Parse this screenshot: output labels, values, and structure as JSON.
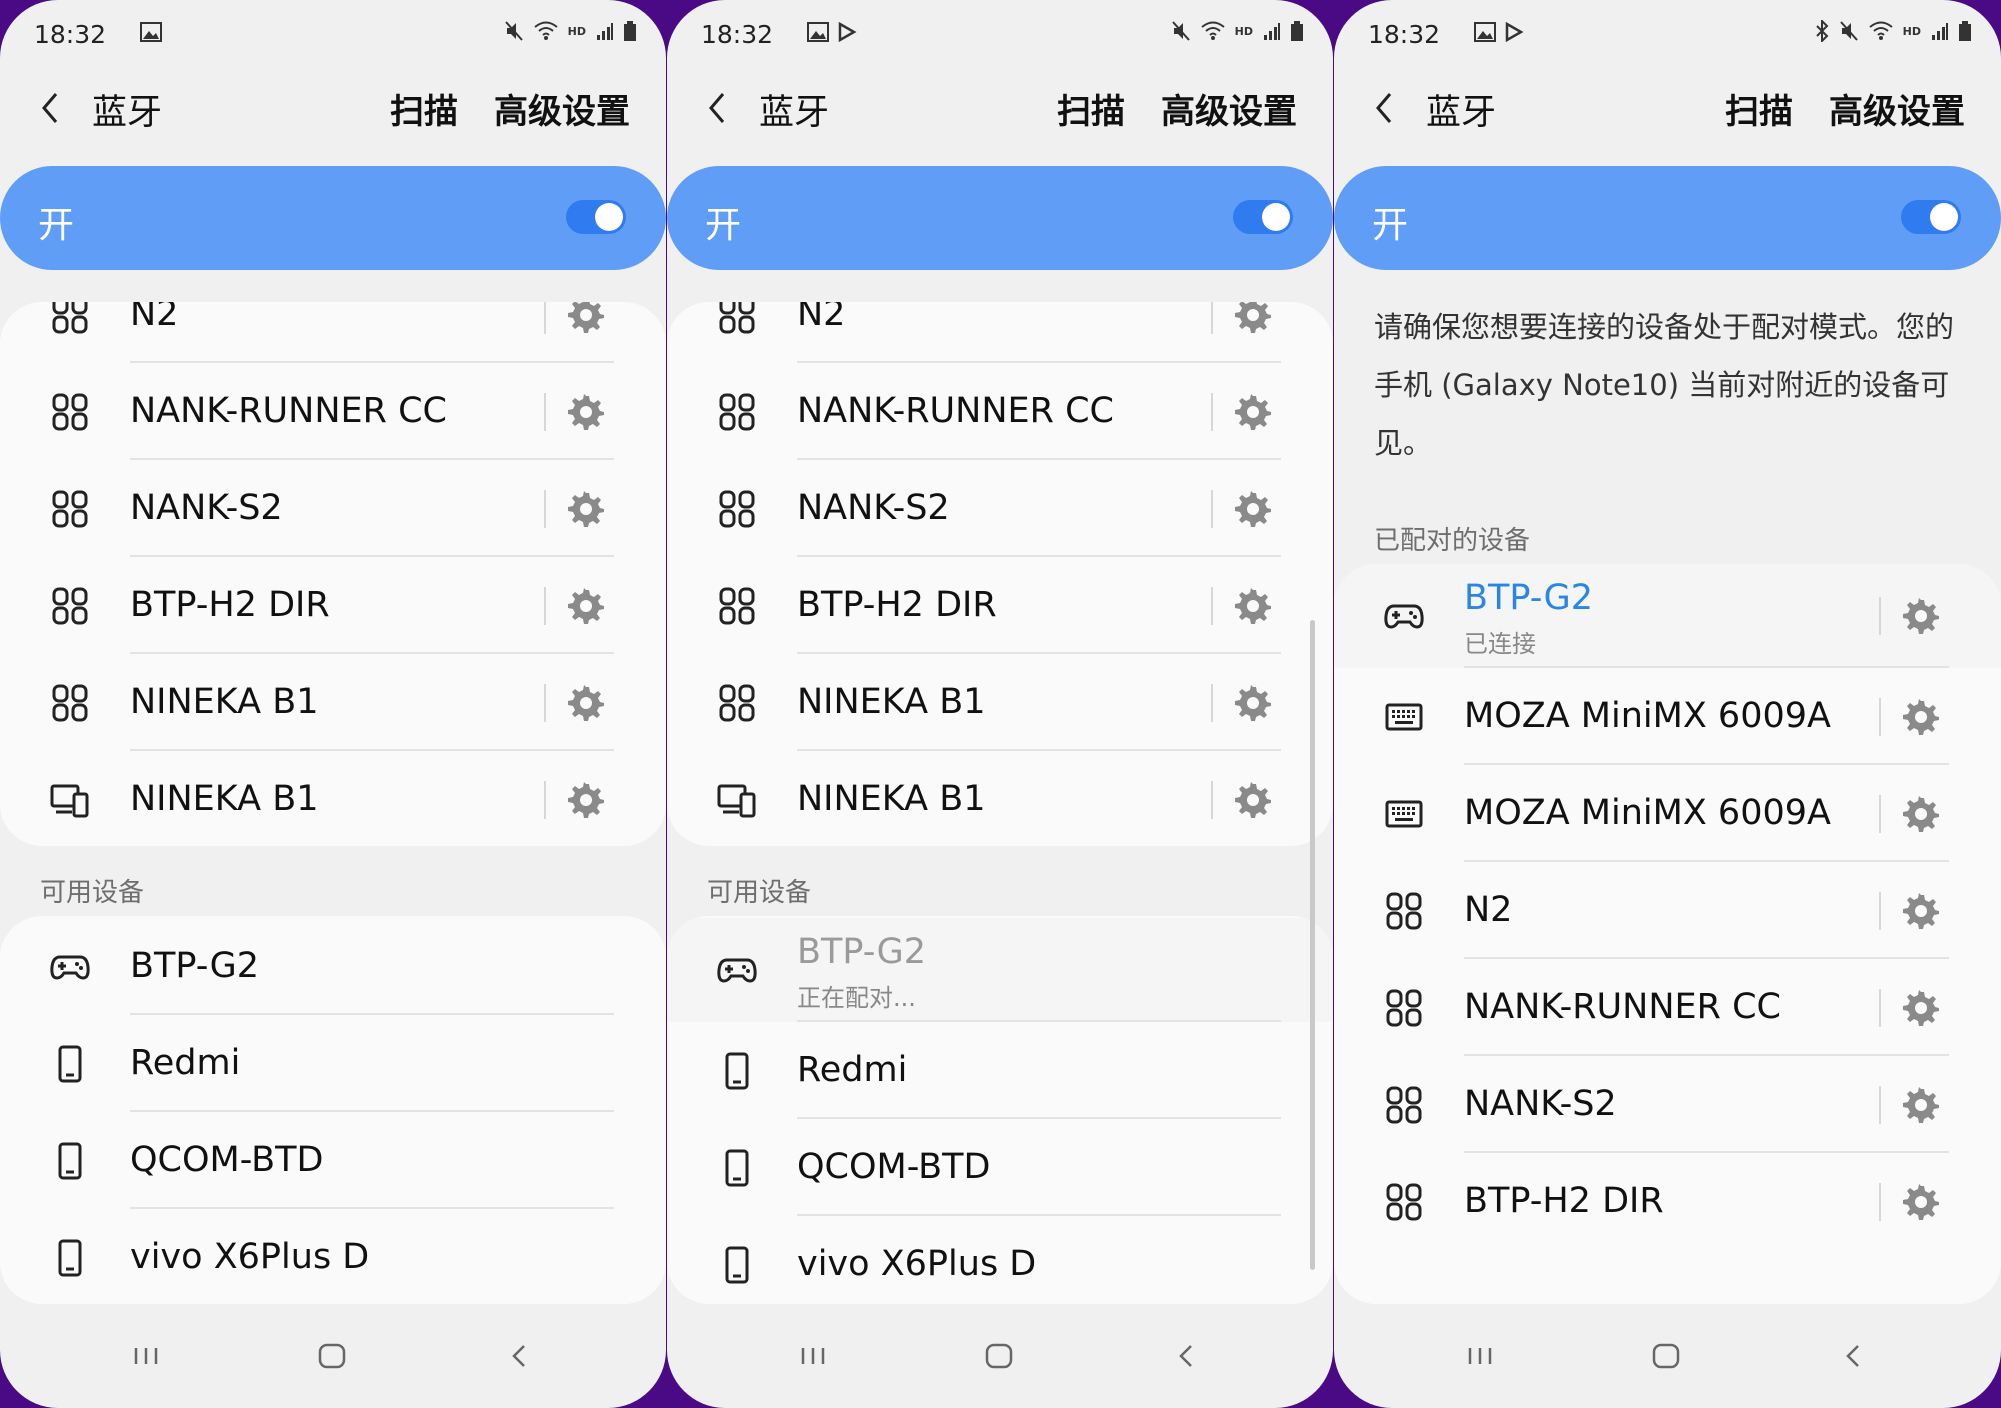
{
  "panels": [
    {
      "status": {
        "time": "18:32",
        "left_icons": [
          "image-icon"
        ],
        "right_icons": [
          "mute-icon",
          "wifi-icon",
          "hd-icon",
          "signal-icon",
          "battery-icon"
        ],
        "hd_text": "HD"
      },
      "header": {
        "title": "蓝牙",
        "scan": "扫描",
        "advanced": "高级设置"
      },
      "switch": {
        "label": "开",
        "on": true
      },
      "paired": [
        {
          "name": "N2",
          "icon": "grid-device-icon"
        },
        {
          "name": "NANK-RUNNER CC",
          "icon": "grid-device-icon"
        },
        {
          "name": "NANK-S2",
          "icon": "grid-device-icon"
        },
        {
          "name": "BTP-H2 DIR",
          "icon": "grid-device-icon"
        },
        {
          "name": "NINEKA B1",
          "icon": "grid-device-icon"
        },
        {
          "name": "NINEKA B1",
          "icon": "devices-icon"
        }
      ],
      "available_header": "可用设备",
      "available": [
        {
          "name": "BTP-G2",
          "icon": "gamepad-icon"
        },
        {
          "name": "Redmi",
          "icon": "phone-icon"
        },
        {
          "name": "QCOM-BTD",
          "icon": "phone-icon"
        },
        {
          "name": "vivo X6Plus D",
          "icon": "phone-icon"
        }
      ]
    },
    {
      "status": {
        "time": "18:32",
        "left_icons": [
          "image-icon",
          "play-icon"
        ],
        "right_icons": [
          "mute-icon",
          "wifi-icon",
          "hd-icon",
          "signal-icon",
          "battery-icon"
        ],
        "hd_text": "HD"
      },
      "header": {
        "title": "蓝牙",
        "scan": "扫描",
        "advanced": "高级设置"
      },
      "switch": {
        "label": "开",
        "on": true
      },
      "paired": [
        {
          "name": "N2",
          "icon": "grid-device-icon"
        },
        {
          "name": "NANK-RUNNER CC",
          "icon": "grid-device-icon"
        },
        {
          "name": "NANK-S2",
          "icon": "grid-device-icon"
        },
        {
          "name": "BTP-H2 DIR",
          "icon": "grid-device-icon"
        },
        {
          "name": "NINEKA B1",
          "icon": "grid-device-icon"
        },
        {
          "name": "NINEKA B1",
          "icon": "devices-icon"
        }
      ],
      "available_header": "可用设备",
      "available": [
        {
          "name": "BTP-G2",
          "icon": "gamepad-icon",
          "status": "正在配对..."
        },
        {
          "name": "Redmi",
          "icon": "phone-icon"
        },
        {
          "name": "QCOM-BTD",
          "icon": "phone-icon"
        },
        {
          "name": "vivo X6Plus D",
          "icon": "phone-icon"
        }
      ]
    },
    {
      "status": {
        "time": "18:32",
        "left_icons": [
          "image-icon",
          "play-icon"
        ],
        "right_icons": [
          "bluetooth-icon",
          "mute-icon",
          "wifi-icon",
          "hd-icon",
          "signal-icon",
          "battery-icon"
        ],
        "hd_text": "HD"
      },
      "header": {
        "title": "蓝牙",
        "scan": "扫描",
        "advanced": "高级设置"
      },
      "switch": {
        "label": "开",
        "on": true
      },
      "note": "请确保您想要连接的设备处于配对模式。您的手机 (Galaxy Note10) 当前对附近的设备可见。",
      "paired_header": "已配对的设备",
      "paired": [
        {
          "name": "BTP-G2",
          "icon": "gamepad-icon",
          "status": "已连接",
          "connected": true
        },
        {
          "name": "MOZA MiniMX 6009A",
          "icon": "keyboard-icon"
        },
        {
          "name": "MOZA MiniMX 6009A",
          "icon": "keyboard-icon"
        },
        {
          "name": "N2",
          "icon": "grid-device-icon"
        },
        {
          "name": "NANK-RUNNER CC",
          "icon": "grid-device-icon"
        },
        {
          "name": "NANK-S2",
          "icon": "grid-device-icon"
        },
        {
          "name": "BTP-H2 DIR",
          "icon": "grid-device-icon"
        }
      ]
    }
  ],
  "colors": {
    "accent": "#2f7bef",
    "switch_bar": "#5f9df7",
    "connected_text": "#2a86e6",
    "background": "#4a0a86"
  }
}
